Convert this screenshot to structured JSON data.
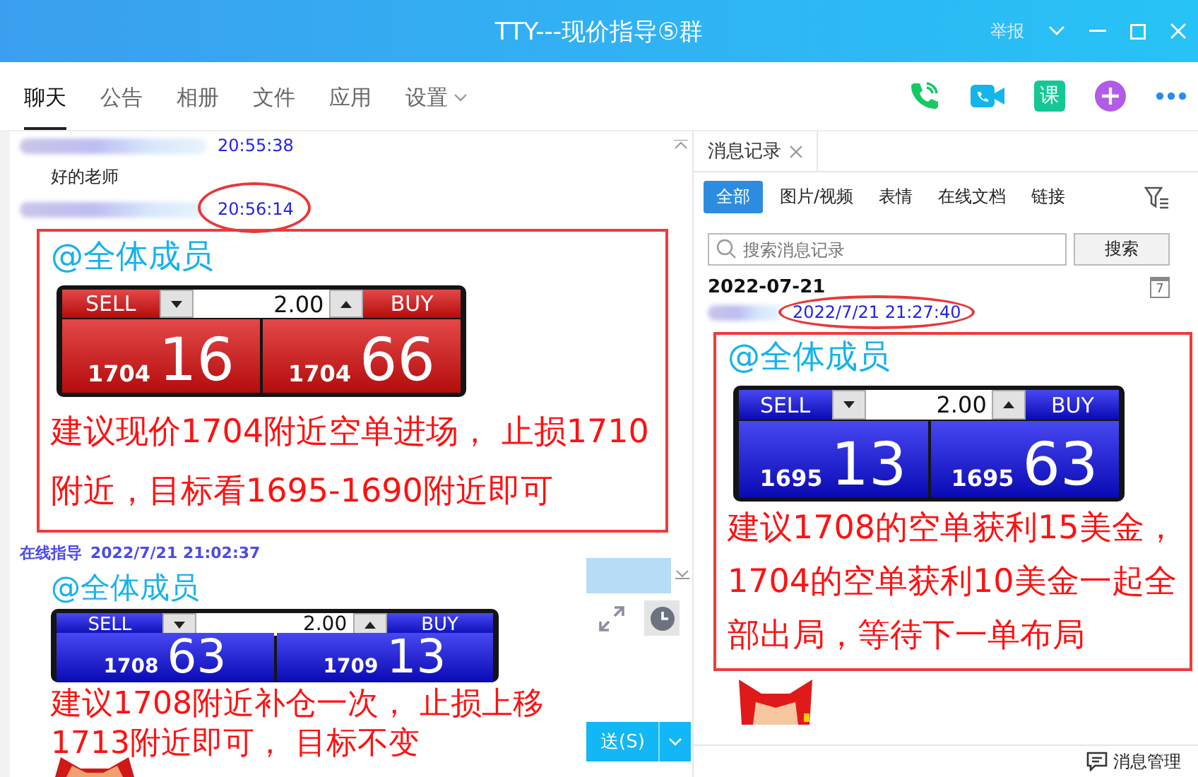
{
  "window": {
    "title": "TTY---现价指导⑤群",
    "report": "举报"
  },
  "tabs": [
    {
      "label": "聊天",
      "selected": true,
      "dropdown": false
    },
    {
      "label": "公告",
      "selected": false,
      "dropdown": false
    },
    {
      "label": "相册",
      "selected": false,
      "dropdown": false
    },
    {
      "label": "文件",
      "selected": false,
      "dropdown": false
    },
    {
      "label": "应用",
      "selected": false,
      "dropdown": false
    },
    {
      "label": "设置",
      "selected": false,
      "dropdown": true
    }
  ],
  "toolbar": {
    "course_label": "课"
  },
  "chat": {
    "messages": [
      {
        "time": "20:55:38",
        "circled": false,
        "boxed": false,
        "text": "好的老师"
      },
      {
        "time": "20:56:14",
        "circled": true,
        "boxed": true,
        "mention": "@全体成员",
        "panel": {
          "kind": "red",
          "sell": "SELL",
          "qty": "2.00",
          "buy": "BUY",
          "bid_prefix": "1704",
          "bid": "16",
          "ask_prefix": "1704",
          "ask": "66"
        },
        "text": "建议现价1704附近空单进场， 止损1710附近，目标看1695-1690附近即可"
      },
      {
        "sender": "在线指导",
        "time": "2022/7/21 21:02:37",
        "circled": false,
        "boxed": false,
        "mention": "@全体成员",
        "panel": {
          "kind": "blue",
          "sell": "SELL",
          "qty": "2.00",
          "buy": "BUY",
          "bid_prefix": "1708",
          "bid": "63",
          "ask_prefix": "1709",
          "ask": "13"
        },
        "text": "建议1708附近补仓一次， 止损上移1713附近即可， 目标不变"
      }
    ]
  },
  "send_button": {
    "label": "送(S)"
  },
  "history": {
    "tab": "消息记录",
    "filters": [
      {
        "label": "全部",
        "selected": true
      },
      {
        "label": "图片/视频",
        "selected": false
      },
      {
        "label": "表情",
        "selected": false
      },
      {
        "label": "在线文档",
        "selected": false
      },
      {
        "label": "链接",
        "selected": false
      }
    ],
    "search": {
      "placeholder": "搜索消息记录",
      "button": "搜索"
    },
    "date": "2022-07-21",
    "calendar_day": "7",
    "message": {
      "time": "2022/7/21 21:27:40",
      "circled": true,
      "boxed": true,
      "mention": "@全体成员",
      "panel": {
        "kind": "blue",
        "sell": "SELL",
        "qty": "2.00",
        "buy": "BUY",
        "bid_prefix": "1695",
        "bid": "13",
        "ask_prefix": "1695",
        "ask": "63"
      },
      "text": "建议1708的空单获利15美金，1704的空单获利10美金一起全部出局，等待下一单布局"
    },
    "manage": "消息管理"
  }
}
